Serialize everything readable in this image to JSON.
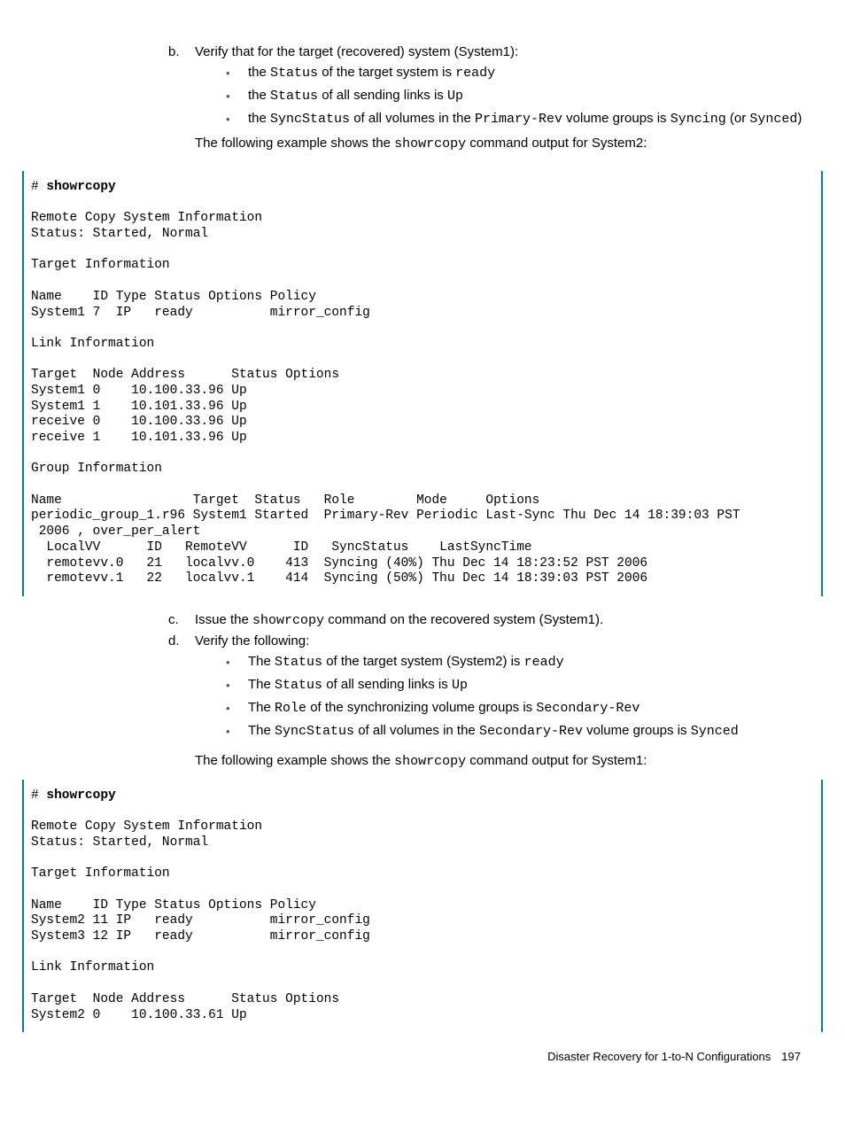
{
  "step_b": {
    "marker": "b.",
    "text_pre": "Verify that for the target (recovered) system (System1):",
    "bullets": [
      {
        "pre": "the ",
        "c1": "Status",
        "mid1": " of the target system is ",
        "c2": "ready",
        "post": ""
      },
      {
        "pre": "the ",
        "c1": "Status",
        "mid1": " of all sending links is ",
        "c2": "Up",
        "post": ""
      },
      {
        "pre": "the ",
        "c1": "SyncStatus",
        "mid1": " of all volumes in the ",
        "c2": "Primary-Rev",
        "mid2": " volume groups is ",
        "c3": "Syncing",
        "mid3": " (or ",
        "c4": "Synced",
        "post": ")"
      }
    ],
    "after_pre": "The following example shows the ",
    "after_code": "showrcopy",
    "after_post": " command output for System2:"
  },
  "code1": {
    "prompt": "# ",
    "cmd": "showrcopy",
    "body": "\nRemote Copy System Information\nStatus: Started, Normal\n\nTarget Information\n\nName    ID Type Status Options Policy\nSystem1 7  IP   ready          mirror_config\n\nLink Information\n\nTarget  Node Address      Status Options\nSystem1 0    10.100.33.96 Up\nSystem1 1    10.101.33.96 Up\nreceive 0    10.100.33.96 Up\nreceive 1    10.101.33.96 Up\n\nGroup Information\n\nName                 Target  Status   Role        Mode     Options\nperiodic_group_1.r96 System1 Started  Primary-Rev Periodic Last-Sync Thu Dec 14 18:39:03 PST\n 2006 , over_per_alert\n  LocalVV      ID   RemoteVV      ID   SyncStatus    LastSyncTime\n  remotevv.0   21   localvv.0    413  Syncing (40%) Thu Dec 14 18:23:52 PST 2006\n  remotevv.1   22   localvv.1    414  Syncing (50%) Thu Dec 14 18:39:03 PST 2006"
  },
  "step_c": {
    "marker": "c.",
    "pre": "Issue the ",
    "code": "showrcopy",
    "post": " command on the recovered system (System1)."
  },
  "step_d": {
    "marker": "d.",
    "text": "Verify the following:",
    "bullets": [
      {
        "pre": "The ",
        "c1": "Status",
        "mid1": " of the target system (System2) is ",
        "c2": "ready",
        "post": ""
      },
      {
        "pre": "The ",
        "c1": "Status",
        "mid1": " of all sending links is ",
        "c2": "Up",
        "post": ""
      },
      {
        "pre": "The ",
        "c1": "Role",
        "mid1": " of the synchronizing volume groups is ",
        "c2": "Secondary-Rev",
        "post": ""
      },
      {
        "pre": "The ",
        "c1": "SyncStatus",
        "mid1": " of all volumes in the ",
        "c2": "Secondary-Rev",
        "mid2": " volume groups is ",
        "c3": "Synced",
        "post": ""
      }
    ],
    "after_pre": "The following example shows the ",
    "after_code": "showrcopy",
    "after_post": " command output for System1:"
  },
  "code2": {
    "prompt": "# ",
    "cmd": "showrcopy",
    "body": "\nRemote Copy System Information\nStatus: Started, Normal\n\nTarget Information\n\nName    ID Type Status Options Policy\nSystem2 11 IP   ready          mirror_config\nSystem3 12 IP   ready          mirror_config\n\nLink Information\n\nTarget  Node Address      Status Options\nSystem2 0    10.100.33.61 Up"
  },
  "footer": {
    "title": "Disaster Recovery for 1-to-N Configurations",
    "page": "197"
  }
}
